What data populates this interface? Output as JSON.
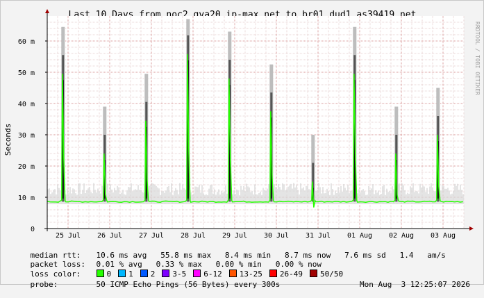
{
  "chart_data": {
    "type": "line",
    "title": "Last 10 Days from noc2.gva20.ip-max.net to br01.dud1.as39419.net",
    "ylabel": "Seconds",
    "side_label": "RRDTOOL / TOBI OETIKER",
    "y_ticks": [
      "0",
      "10 m",
      "20 m",
      "30 m",
      "40 m",
      "50 m",
      "60 m"
    ],
    "y_tick_values": [
      0,
      10,
      20,
      30,
      40,
      50,
      60
    ],
    "ylim": [
      0,
      68
    ],
    "x_ticks": [
      "25 Jul",
      "26 Jul",
      "27 Jul",
      "28 Jul",
      "29 Jul",
      "30 Jul",
      "31 Jul",
      "01 Aug",
      "02 Aug",
      "03 Aug"
    ],
    "x_day_range": [
      0,
      10
    ],
    "grid": true,
    "series": [
      {
        "name": "median rtt",
        "baseline_ms": 8.6,
        "spikes": [
          {
            "day": 0.38,
            "peak_ms": 49.5
          },
          {
            "day": 1.38,
            "peak_ms": 24
          },
          {
            "day": 2.38,
            "peak_ms": 34.5
          },
          {
            "day": 3.38,
            "peak_ms": 55.8
          },
          {
            "day": 4.38,
            "peak_ms": 48
          },
          {
            "day": 5.38,
            "peak_ms": 37.5
          },
          {
            "day": 6.38,
            "peak_ms": 15
          },
          {
            "day": 7.38,
            "peak_ms": 49.5
          },
          {
            "day": 8.38,
            "peak_ms": 24
          },
          {
            "day": 9.38,
            "peak_ms": 30
          }
        ]
      }
    ]
  },
  "stats": {
    "median_label": "median rtt:",
    "median_values": "10.6 ms avg   55.8 ms max   8.4 ms min   8.7 ms now   7.6 ms sd   1.4   am/s",
    "loss_label": "packet loss:",
    "loss_values": "0.01 % avg   0.33 % max   0.00 % min   0.00 % now",
    "color_label": "loss color:",
    "legend": [
      {
        "label": "0",
        "color": "#26ff00"
      },
      {
        "label": "1",
        "color": "#00b8ff"
      },
      {
        "label": "2",
        "color": "#0059ff"
      },
      {
        "label": "3-5",
        "color": "#7e00ff"
      },
      {
        "label": "6-12",
        "color": "#ff00ff"
      },
      {
        "label": "13-25",
        "color": "#ff5500"
      },
      {
        "label": "26-49",
        "color": "#ff0000"
      },
      {
        "label": "50/50",
        "color": "#a00000"
      }
    ],
    "probe_label": "probe:",
    "probe_text": "50 ICMP Echo Pings (56 Bytes) every 300s",
    "timestamp": "Mon Aug  3 12:25:07 2026"
  }
}
